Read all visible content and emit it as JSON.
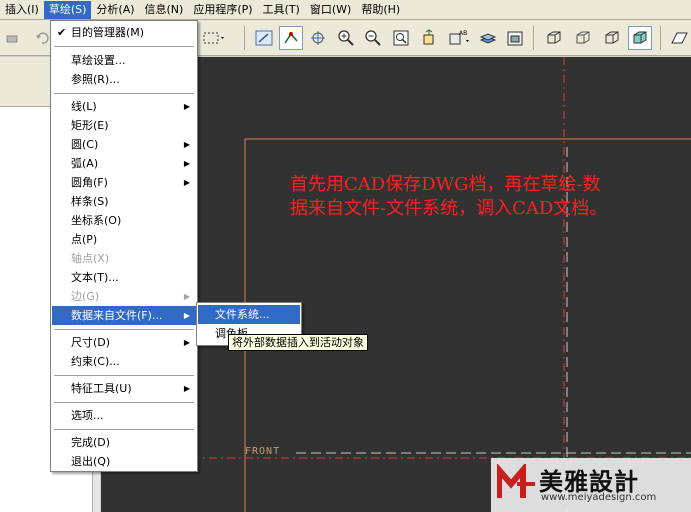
{
  "menubar": {
    "items": [
      "插入(I)",
      "草绘(S)",
      "分析(A)",
      "信息(N)",
      "应用程序(P)",
      "工具(T)",
      "窗口(W)",
      "帮助(H)"
    ],
    "active_index": 1
  },
  "sketch_menu": {
    "items": [
      {
        "label": "目的管理器(M)",
        "checked": true
      },
      {
        "label": "草绘设置..."
      },
      {
        "label": "参照(R)..."
      },
      {
        "label": "线(L)",
        "submenu": true
      },
      {
        "label": "矩形(E)"
      },
      {
        "label": "圆(C)",
        "submenu": true
      },
      {
        "label": "弧(A)",
        "submenu": true
      },
      {
        "label": "圆角(F)",
        "submenu": true
      },
      {
        "label": "样条(S)"
      },
      {
        "label": "坐标系(O)"
      },
      {
        "label": "点(P)"
      },
      {
        "label": "轴点(X)",
        "disabled": true
      },
      {
        "label": "文本(T)..."
      },
      {
        "label": "边(G)",
        "submenu": true,
        "disabled": true
      },
      {
        "label": "数据来自文件(F)...",
        "submenu": true,
        "highlighted": true
      },
      {
        "label": "尺寸(D)",
        "submenu": true
      },
      {
        "label": "约束(C)..."
      },
      {
        "label": "特征工具(U)",
        "submenu": true
      },
      {
        "label": "选项..."
      },
      {
        "label": "完成(D)"
      },
      {
        "label": "退出(Q)"
      }
    ]
  },
  "submenu": {
    "items": [
      "文件系统...",
      "调色板..."
    ]
  },
  "tooltip": "将外部数据插入到活动对象",
  "canvas": {
    "note": "首先用CAD保存DWG档，再在草绘-数据来自文件-文件系统，调入CAD文档。",
    "front_label": "FRONT",
    "background": "#333232",
    "accent_red": "#ff2020"
  },
  "watermark": {
    "brand": "美雅設計",
    "url": "www.meiyadesign.com"
  }
}
